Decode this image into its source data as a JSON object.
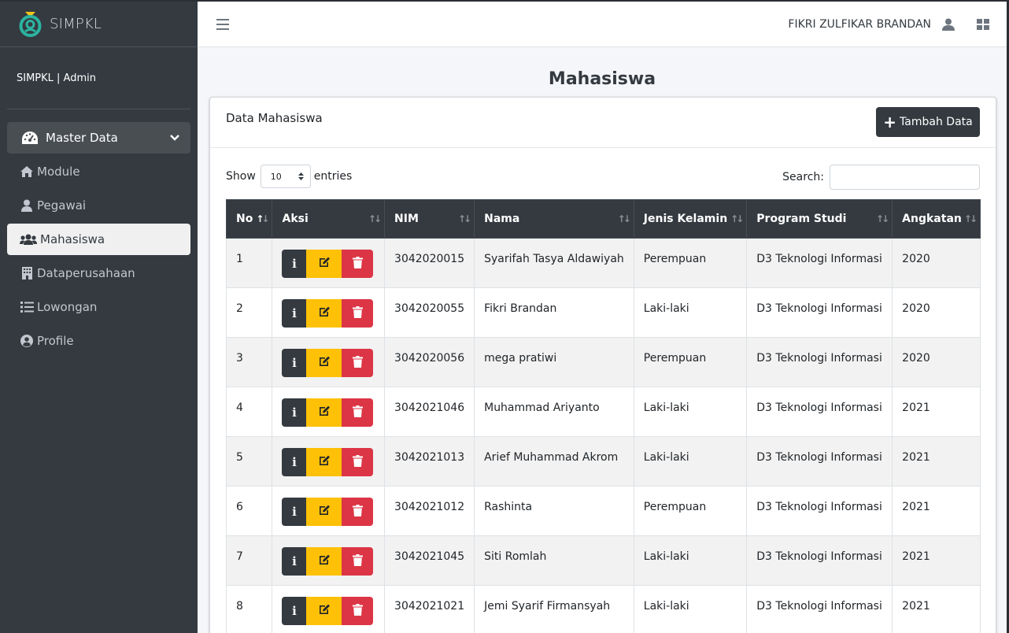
{
  "app": {
    "brand": "SIMPKL",
    "user_panel": "SIMPKL | Admin"
  },
  "colors": {
    "sidebar": "#343a40",
    "primary_dark": "#343a40",
    "warning": "#ffc107",
    "danger": "#dc3545"
  },
  "sidebar": {
    "parent": {
      "label": "Master Data",
      "icon": "dashboard-icon"
    },
    "items": [
      {
        "label": "Module",
        "icon": "home-icon"
      },
      {
        "label": "Pegawai",
        "icon": "user-icon"
      },
      {
        "label": "Mahasiswa",
        "icon": "users-icon",
        "active": true
      },
      {
        "label": "Dataperusahaan",
        "icon": "building-icon"
      },
      {
        "label": "Lowongan",
        "icon": "list-icon"
      },
      {
        "label": "Profile",
        "icon": "user-circle-icon"
      }
    ]
  },
  "topbar": {
    "username": "FIKRI ZULFIKAR BRANDAN"
  },
  "page": {
    "title": "Mahasiswa"
  },
  "card": {
    "title": "Data Mahasiswa",
    "add_button": "Tambah Data"
  },
  "controls": {
    "show_label": "Show",
    "entries_value": "10",
    "entries_label": "entries",
    "search_label": "Search:"
  },
  "table": {
    "columns": [
      "No",
      "Aksi",
      "NIM",
      "Nama",
      "Jenis Kelamin",
      "Program Studi",
      "Angkatan"
    ],
    "rows": [
      [
        "1",
        "3042020015",
        "Syarifah Tasya Aldawiyah",
        "Perempuan",
        "D3 Teknologi Informasi",
        "2020"
      ],
      [
        "2",
        "3042020055",
        "Fikri Brandan",
        "Laki-laki",
        "D3 Teknologi Informasi",
        "2020"
      ],
      [
        "3",
        "3042020056",
        "mega pratiwi",
        "Perempuan",
        "D3 Teknologi Informasi",
        "2020"
      ],
      [
        "4",
        "3042021046",
        "Muhammad Ariyanto",
        "Laki-laki",
        "D3 Teknologi Informasi",
        "2021"
      ],
      [
        "5",
        "3042021013",
        "Arief Muhammad Akrom",
        "Laki-laki",
        "D3 Teknologi Informasi",
        "2021"
      ],
      [
        "6",
        "3042021012",
        "Rashinta",
        "Perempuan",
        "D3 Teknologi Informasi",
        "2021"
      ],
      [
        "7",
        "3042021045",
        "Siti Romlah",
        "Laki-laki",
        "D3 Teknologi Informasi",
        "2021"
      ],
      [
        "8",
        "3042021021",
        "Jemi Syarif Firmansyah",
        "Laki-laki",
        "D3 Teknologi Informasi",
        "2021"
      ]
    ]
  }
}
